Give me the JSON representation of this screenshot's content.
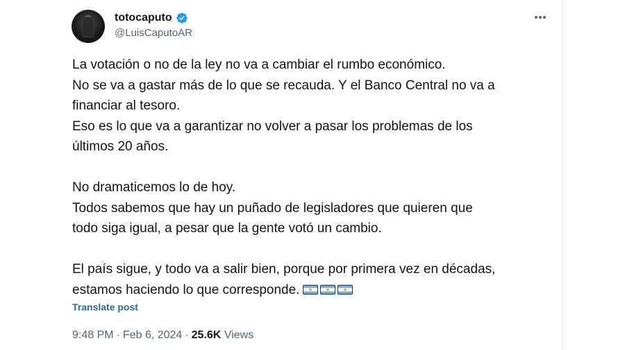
{
  "tweet": {
    "author": {
      "display_name": "totocaputo",
      "handle": "@LuisCaputoAR",
      "verified": true,
      "avatar_icon": "profile-photo"
    },
    "paragraphs": [
      {
        "lines": [
          "La votación o no de la ley no va a cambiar el rumbo económico.",
          "No se va a gastar más de lo que se recauda. Y el Banco Central no va a",
          "financiar al tesoro.",
          "Eso es lo que va a garantizar no volver a pasar los problemas de los",
          "últimos 20 años."
        ]
      },
      {
        "lines": [
          "No dramaticemos lo de hoy.",
          "Todos sabemos que hay un puñado de legisladores que quieren que",
          "todo siga igual, a pesar que la gente votó un cambio."
        ]
      },
      {
        "lines": [
          "El país sigue, y todo va a salir bien, porque por primera vez en décadas,",
          "estamos haciendo lo que corresponde."
        ],
        "trailing_emoji": [
          "argentina-flag",
          "argentina-flag",
          "argentina-flag"
        ]
      }
    ],
    "translate_label": "Translate post",
    "time": "9:48 PM",
    "separator": "·",
    "date": "Feb 6, 2024",
    "views_count": "25.6K",
    "views_label": "Views"
  },
  "colors": {
    "text": "#0f1419",
    "secondary": "#536471",
    "link": "#1d6fa5",
    "verified": "#1d9bf0"
  }
}
